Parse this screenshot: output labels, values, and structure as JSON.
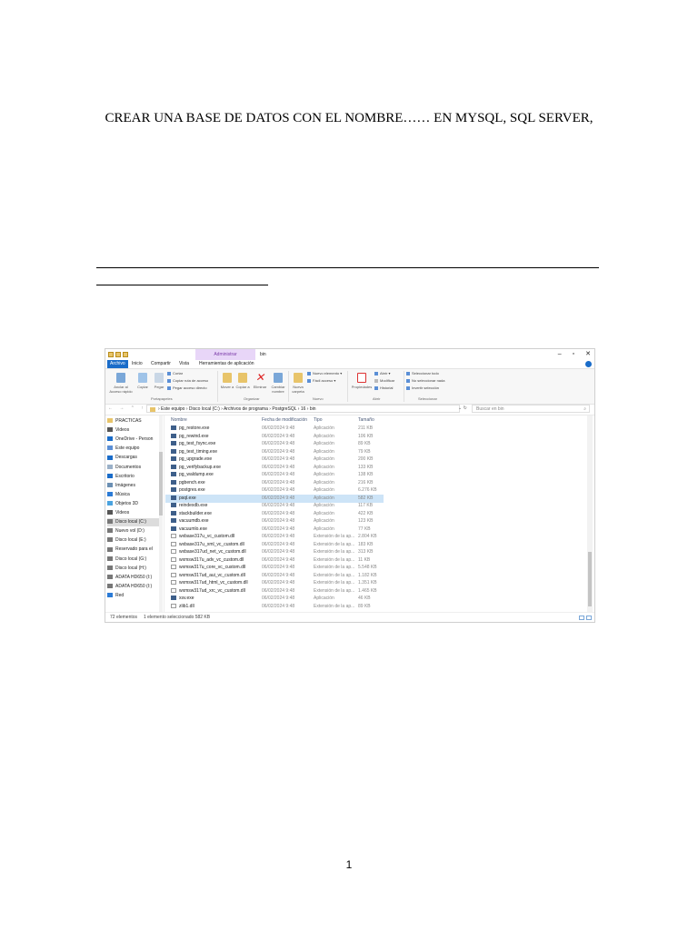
{
  "document": {
    "heading": "CREAR UNA BASE DE DATOS CON EL NOMBRE…… EN MYSQL, SQL SERVER,",
    "page_number": "1"
  },
  "window": {
    "admin_tab": "Administrar",
    "title": "bin",
    "controls": [
      "–",
      "▫",
      "✕"
    ],
    "tabs": [
      "Archivo",
      "Inicio",
      "Compartir",
      "Vista",
      "Herramientas de aplicación"
    ],
    "ribbon": {
      "pin_label": "Anclar al Acceso rápido",
      "copy_label": "Copiar",
      "paste_label": "Pegar",
      "cut_label": "Cortar",
      "copy_path_label": "Copiar ruta de acceso",
      "paste_shortcut_label": "Pegar acceso directo",
      "move_label": "Mover a",
      "copy_to_label": "Copiar a",
      "delete_label": "Eliminar",
      "rename_label": "Cambiar nombre",
      "new_folder_label": "Nueva carpeta",
      "new_item_label": "Nuevo elemento ▾",
      "easy_access_label": "Fácil acceso ▾",
      "properties_label": "Propiedades",
      "open_label": "Abrir ▾",
      "edit_label": "Modificar",
      "history_label": "Historial",
      "select_all_label": "Seleccionar todo",
      "select_none_label": "No seleccionar nada",
      "invert_label": "Invertir selección",
      "groups": [
        "Portapapeles",
        "Organizar",
        "Nuevo",
        "Abrir",
        "Seleccionar"
      ]
    },
    "address": {
      "path": "›  Este equipo  ›  Disco local (C:)  ›  Archivos de programa  ›  PostgreSQL  ›  16  ›  bin",
      "search_placeholder": "Buscar en bin"
    },
    "sidebar": [
      {
        "label": "PRACTICAS",
        "color": "#e8c46a"
      },
      {
        "label": "Videos",
        "color": "#555555"
      },
      {
        "label": "OneDrive - Person",
        "color": "#1a6cc9"
      },
      {
        "label": "Este equipo",
        "color": "#5b8fd6"
      },
      {
        "label": "Descargas",
        "color": "#1a6cc9"
      },
      {
        "label": "Documentos",
        "color": "#9ab0c8"
      },
      {
        "label": "Escritorio",
        "color": "#1a6cc9"
      },
      {
        "label": "Imágenes",
        "color": "#6b8fb3"
      },
      {
        "label": "Música",
        "color": "#2b7bd6"
      },
      {
        "label": "Objetos 3D",
        "color": "#4aa3df"
      },
      {
        "label": "Videos",
        "color": "#555555"
      },
      {
        "label": "Disco local (C:)",
        "color": "#777777"
      },
      {
        "label": "Nuevo vol (D:)",
        "color": "#777777"
      },
      {
        "label": "Disco local (E:)",
        "color": "#777777"
      },
      {
        "label": "Reservado para el",
        "color": "#777777"
      },
      {
        "label": "Disco local (G:)",
        "color": "#777777"
      },
      {
        "label": "Disco local (H:)",
        "color": "#777777"
      },
      {
        "label": "ADATA HD650 (I:)",
        "color": "#777777"
      },
      {
        "label": "ADATA HD650 (I:)",
        "color": "#777777"
      },
      {
        "label": "Red",
        "color": "#2b7bd6"
      }
    ],
    "columns": [
      "Nombre",
      "Fecha de modificación",
      "Tipo",
      "Tamaño"
    ],
    "files": [
      {
        "name": "pg_restore.exe",
        "date": "06/02/2024 9:48",
        "type": "Aplicación",
        "size": "211 KB",
        "icon": "exe"
      },
      {
        "name": "pg_rewind.exe",
        "date": "06/02/2024 9:48",
        "type": "Aplicación",
        "size": "106 KB",
        "icon": "exe"
      },
      {
        "name": "pg_test_fsync.exe",
        "date": "06/02/2024 9:48",
        "type": "Aplicación",
        "size": "89 KB",
        "icon": "exe"
      },
      {
        "name": "pg_test_timing.exe",
        "date": "06/02/2024 9:48",
        "type": "Aplicación",
        "size": "79 KB",
        "icon": "exe"
      },
      {
        "name": "pg_upgrade.exe",
        "date": "06/02/2024 9:48",
        "type": "Aplicación",
        "size": "200 KB",
        "icon": "exe"
      },
      {
        "name": "pg_verifybackup.exe",
        "date": "06/02/2024 9:48",
        "type": "Aplicación",
        "size": "133 KB",
        "icon": "exe"
      },
      {
        "name": "pg_waldump.exe",
        "date": "06/02/2024 9:48",
        "type": "Aplicación",
        "size": "138 KB",
        "icon": "exe"
      },
      {
        "name": "pgbench.exe",
        "date": "06/02/2024 9:48",
        "type": "Aplicación",
        "size": "216 KB",
        "icon": "exe"
      },
      {
        "name": "postgres.exe",
        "date": "06/02/2024 9:48",
        "type": "Aplicación",
        "size": "6.276 KB",
        "icon": "exe"
      },
      {
        "name": "psql.exe",
        "date": "06/02/2024 9:48",
        "type": "Aplicación",
        "size": "582 KB",
        "icon": "exe",
        "selected": true
      },
      {
        "name": "reindexdb.exe",
        "date": "06/02/2024 9:48",
        "type": "Aplicación",
        "size": "117 KB",
        "icon": "exe"
      },
      {
        "name": "stackbuilder.exe",
        "date": "06/02/2024 9:48",
        "type": "Aplicación",
        "size": "422 KB",
        "icon": "exe"
      },
      {
        "name": "vacuumdb.exe",
        "date": "06/02/2024 9:48",
        "type": "Aplicación",
        "size": "123 KB",
        "icon": "exe"
      },
      {
        "name": "vacuumlo.exe",
        "date": "06/02/2024 9:48",
        "type": "Aplicación",
        "size": "77 KB",
        "icon": "exe"
      },
      {
        "name": "wxbase317u_vc_custom.dll",
        "date": "06/02/2024 9:48",
        "type": "Extensión de la ap...",
        "size": "2.804 KB",
        "icon": "dll"
      },
      {
        "name": "wxbase317u_xml_vc_custom.dll",
        "date": "06/02/2024 9:48",
        "type": "Extensión de la ap...",
        "size": "183 KB",
        "icon": "dll"
      },
      {
        "name": "wxbase317ud_net_vc_custom.dll",
        "date": "06/02/2024 9:48",
        "type": "Extensión de la ap...",
        "size": "313 KB",
        "icon": "dll"
      },
      {
        "name": "wxmsw317u_adv_vc_custom.dll",
        "date": "06/02/2024 9:48",
        "type": "Extensión de la ap...",
        "size": "11 KB",
        "icon": "dll"
      },
      {
        "name": "wxmsw317u_core_vc_custom.dll",
        "date": "06/02/2024 9:48",
        "type": "Extensión de la ap...",
        "size": "5.548 KB",
        "icon": "dll"
      },
      {
        "name": "wxmsw317ud_aui_vc_custom.dll",
        "date": "06/02/2024 9:48",
        "type": "Extensión de la ap...",
        "size": "1.182 KB",
        "icon": "dll"
      },
      {
        "name": "wxmsw317ud_html_vc_custom.dll",
        "date": "06/02/2024 9:48",
        "type": "Extensión de la ap...",
        "size": "1.351 KB",
        "icon": "dll"
      },
      {
        "name": "wxmsw317ud_xrc_vc_custom.dll",
        "date": "06/02/2024 9:48",
        "type": "Extensión de la ap...",
        "size": "1.465 KB",
        "icon": "dll"
      },
      {
        "name": "xsv.exe",
        "date": "06/02/2024 9:48",
        "type": "Aplicación",
        "size": "46 KB",
        "icon": "exe"
      },
      {
        "name": "zlib1.dll",
        "date": "06/02/2024 9:48",
        "type": "Extensión de la ap...",
        "size": "89 KB",
        "icon": "dll"
      }
    ],
    "status": {
      "count": "72 elementos",
      "selection": "1 elemento seleccionado  582 KB"
    }
  }
}
